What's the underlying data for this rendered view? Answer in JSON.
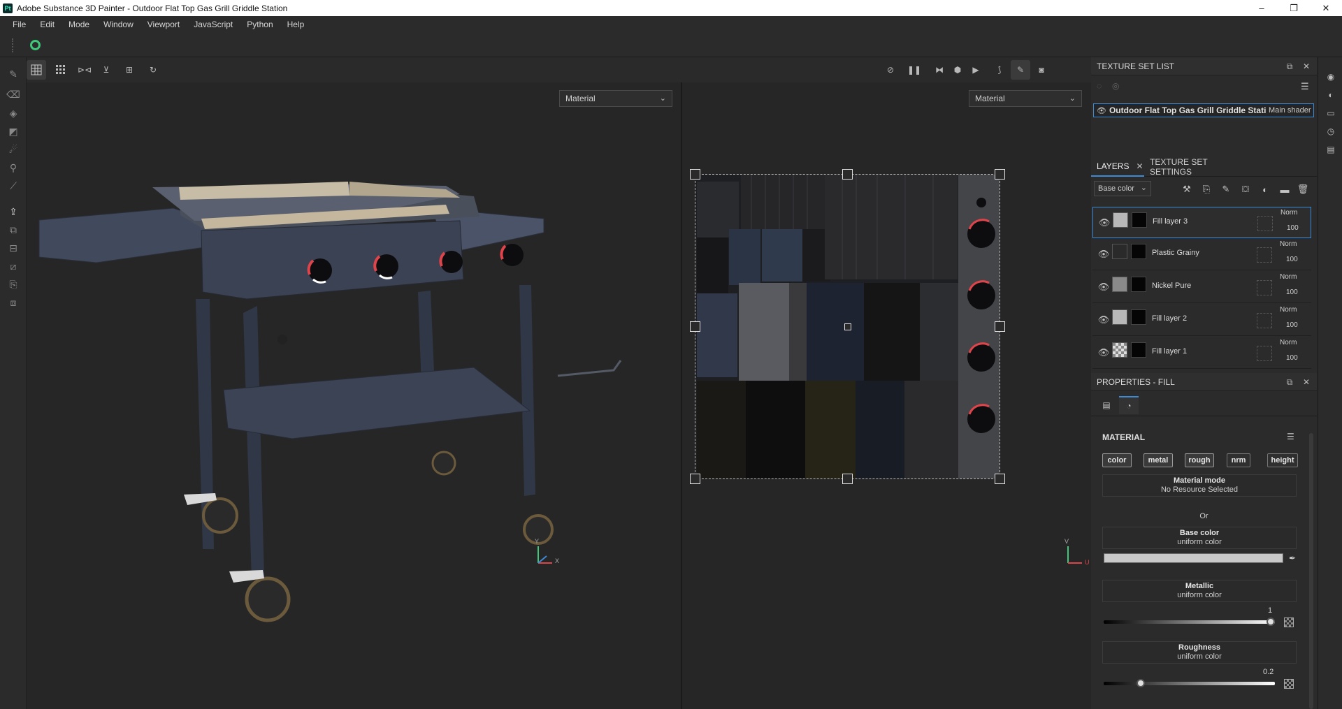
{
  "window": {
    "title": "Adobe Substance 3D Painter - Outdoor Flat Top Gas Grill Griddle Station",
    "app_badge": "Pt",
    "minimize": "–",
    "restore": "❐",
    "close": "✕"
  },
  "menu": [
    "File",
    "Edit",
    "Mode",
    "Window",
    "Viewport",
    "JavaScript",
    "Python",
    "Help"
  ],
  "viewport": {
    "left_mode": "Material",
    "right_mode": "Material",
    "axis_left": {
      "y": "Y",
      "x": "X"
    },
    "axis_right": {
      "v": "V",
      "u": "U"
    }
  },
  "texture_set_list": {
    "title": "TEXTURE SET LIST",
    "row_name": "Outdoor Flat Top Gas Grill Griddle Stati",
    "row_shader": "Main shader"
  },
  "layers_panel": {
    "tab_layers": "LAYERS",
    "tab_texture_settings": "TEXTURE SET SETTINGS",
    "channel": "Base color",
    "layers": [
      {
        "name": "Fill layer 3",
        "blend": "Norm",
        "opacity": "100",
        "thumb": "#b8b8b8",
        "selected": true
      },
      {
        "name": "Plastic Grainy",
        "blend": "Norm",
        "opacity": "100",
        "thumb": "#2a2a2a",
        "selected": false
      },
      {
        "name": "Nickel Pure",
        "blend": "Norm",
        "opacity": "100",
        "thumb": "#8a8a8a",
        "selected": false
      },
      {
        "name": "Fill layer 2",
        "blend": "Norm",
        "opacity": "100",
        "thumb": "#b8b8b8",
        "selected": false
      },
      {
        "name": "Fill layer 1",
        "blend": "Norm",
        "opacity": "100",
        "thumb": "checker",
        "selected": false
      }
    ]
  },
  "properties": {
    "title": "PROPERTIES - FILL",
    "section": "MATERIAL",
    "channels": [
      "color",
      "metal",
      "rough",
      "nrm",
      "height"
    ],
    "material_mode": {
      "title": "Material mode",
      "sub": "No Resource Selected"
    },
    "or": "Or",
    "base_color": {
      "title": "Base color",
      "sub": "uniform color",
      "value": "#c9c9c9"
    },
    "metallic": {
      "title": "Metallic",
      "sub": "uniform color",
      "value": "1",
      "fraction": 1.0
    },
    "roughness": {
      "title": "Roughness",
      "sub": "uniform color",
      "value": "0.2",
      "fraction": 0.2
    }
  },
  "colors": {
    "accent": "#3d8ad6",
    "bg": "#262626",
    "panel": "#2b2b2b",
    "knob_red": "#e0444b"
  }
}
